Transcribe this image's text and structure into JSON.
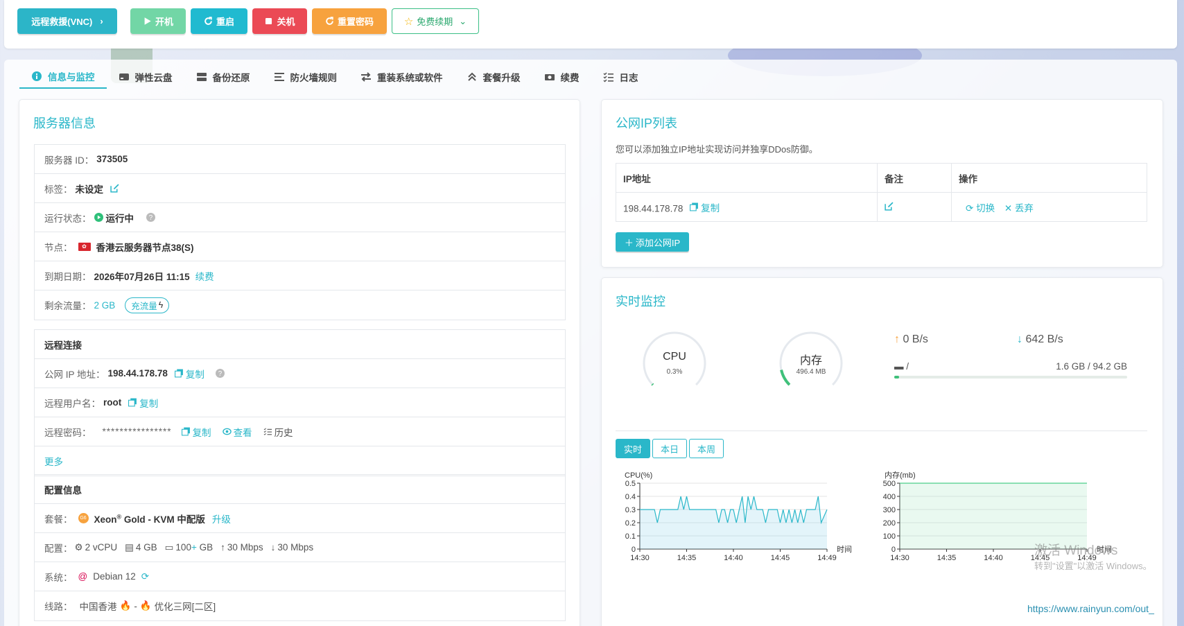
{
  "toolbar": {
    "vnc_label": "远程救援(VNC)",
    "power_on": "开机",
    "restart": "重启",
    "power_off": "关机",
    "reset_password": "重置密码",
    "free_renew": "免费续期",
    "colors": {
      "vnc": "#2cb5c8",
      "power_on": "#72d6a6",
      "restart": "#20bad0",
      "power_off": "#eb4a55",
      "reset_password": "#f7a23e"
    }
  },
  "tabs": [
    {
      "label": "信息与监控",
      "icon": "info-icon"
    },
    {
      "label": "弹性云盘",
      "icon": "disk-icon"
    },
    {
      "label": "备份还原",
      "icon": "backup-icon"
    },
    {
      "label": "防火墙规则",
      "icon": "list-icon"
    },
    {
      "label": "重装系统或软件",
      "icon": "swap-icon"
    },
    {
      "label": "套餐升级",
      "icon": "upgrade-icon"
    },
    {
      "label": "续费",
      "icon": "money-icon"
    },
    {
      "label": "日志",
      "icon": "log-icon"
    }
  ],
  "server": {
    "title": "服务器信息",
    "id_label": "服务器 ID：",
    "id_value": "373505",
    "tag_label": "标签：",
    "tag_value": "未设定",
    "status_label": "运行状态：",
    "status_value": "运行中",
    "node_label": "节点：",
    "node_value": "香港云服务器节点38(S)",
    "expire_label": "到期日期：",
    "expire_value": "2026年07月26日 11:15",
    "renew_link": "续费",
    "traffic_label": "剩余流量：",
    "traffic_value": "2 GB",
    "recharge": "充流量"
  },
  "remote": {
    "title": "远程连接",
    "ip_label": "公网 IP 地址：",
    "ip_value": "198.44.178.78",
    "copy": "复制",
    "user_label": "远程用户名：",
    "user_value": "root",
    "pwd_label": "远程密码：",
    "pwd_value": "****************",
    "view": "查看",
    "history": "历史",
    "more": "更多"
  },
  "config": {
    "title": "配置信息",
    "plan_label": "套餐：",
    "plan_value": "Xeon",
    "plan_sup": "®",
    "plan_rest": " Gold - KVM 中配版",
    "upgrade": "升级",
    "spec_label": "配置：",
    "cpu": "2 vCPU",
    "ram": "4 GB",
    "disk_a": "100",
    "disk_plus": "+",
    "disk_b": " GB",
    "up": "30 Mbps",
    "down": "30 Mbps",
    "os_label": "系统：",
    "os_value": "Debian 12",
    "line_label": "线路：",
    "line_a": "中国香港",
    "line_sep": " - ",
    "line_b": "优化三网[二区]"
  },
  "ips": {
    "title": "公网IP列表",
    "desc": "您可以添加独立IP地址实现访问并独享DDos防御。",
    "headers": [
      "IP地址",
      "备注",
      "操作"
    ],
    "row_ip": "198.44.178.78",
    "copy": "复制",
    "switch": "切换",
    "discard": "丢弃",
    "add": "添加公网IP"
  },
  "monitor": {
    "title": "实时监控",
    "cpu_label": "CPU",
    "cpu_value": "0.3%",
    "cpu_fraction": 0.003,
    "mem_label": "内存",
    "mem_value": "496.4 MB",
    "mem_fraction": 0.12,
    "up_speed": "0 B/s",
    "down_speed": "642 B/s",
    "disk_mount": "/",
    "disk_usage": "1.6 GB / 94.2 GB",
    "disk_fraction": 0.017,
    "range_tabs": [
      "实时",
      "本日",
      "本周"
    ]
  },
  "chart_data": [
    {
      "type": "line",
      "title": "CPU(%)",
      "xlabel": "时间",
      "x_ticks": [
        "14:30",
        "14:35",
        "14:40",
        "14:45",
        "14:49"
      ],
      "y_ticks": [
        "0",
        "0.1",
        "0.2",
        "0.3",
        "0.4",
        "0.5"
      ],
      "ylim": [
        0,
        0.5
      ],
      "series": [
        {
          "values": [
            0.3,
            0.3,
            0.3,
            0.3,
            0.3,
            0.3,
            0.2,
            0.3,
            0.3,
            0.3,
            0.3,
            0.3,
            0.3,
            0.3,
            0.4,
            0.3,
            0.4,
            0.3,
            0.3,
            0.3,
            0.3,
            0.3,
            0.3,
            0.3,
            0.3,
            0.3,
            0.3,
            0.2,
            0.3,
            0.3,
            0.2,
            0.3,
            0.3,
            0.2,
            0.3,
            0.4,
            0.2,
            0.4,
            0.3,
            0.4,
            0.3,
            0.3,
            0.3,
            0.2,
            0.3,
            0.3,
            0.3,
            0.3,
            0.2,
            0.3,
            0.2,
            0.3,
            0.2,
            0.3,
            0.2,
            0.3,
            0.2,
            0.3,
            0.3,
            0.3,
            0.3,
            0.4,
            0.2,
            0.25,
            0.3
          ]
        }
      ],
      "color": "#2ab7c9"
    },
    {
      "type": "area",
      "title": "内存(mb)",
      "xlabel": "时间",
      "x_ticks": [
        "14:30",
        "14:35",
        "14:40",
        "14:45",
        "14:49"
      ],
      "y_ticks": [
        "0",
        "100",
        "200",
        "300",
        "400",
        "500"
      ],
      "ylim": [
        0,
        500
      ],
      "series": [
        {
          "values": [
            500,
            500,
            500,
            500,
            500,
            500,
            500,
            500,
            500,
            500
          ]
        }
      ],
      "color": "#4ccf8a"
    }
  ],
  "watermark": {
    "line1": "激活 Windows",
    "line2": "转到\"设置\"以激活 Windows。",
    "url": "https://www.rainyun.com/out_"
  }
}
